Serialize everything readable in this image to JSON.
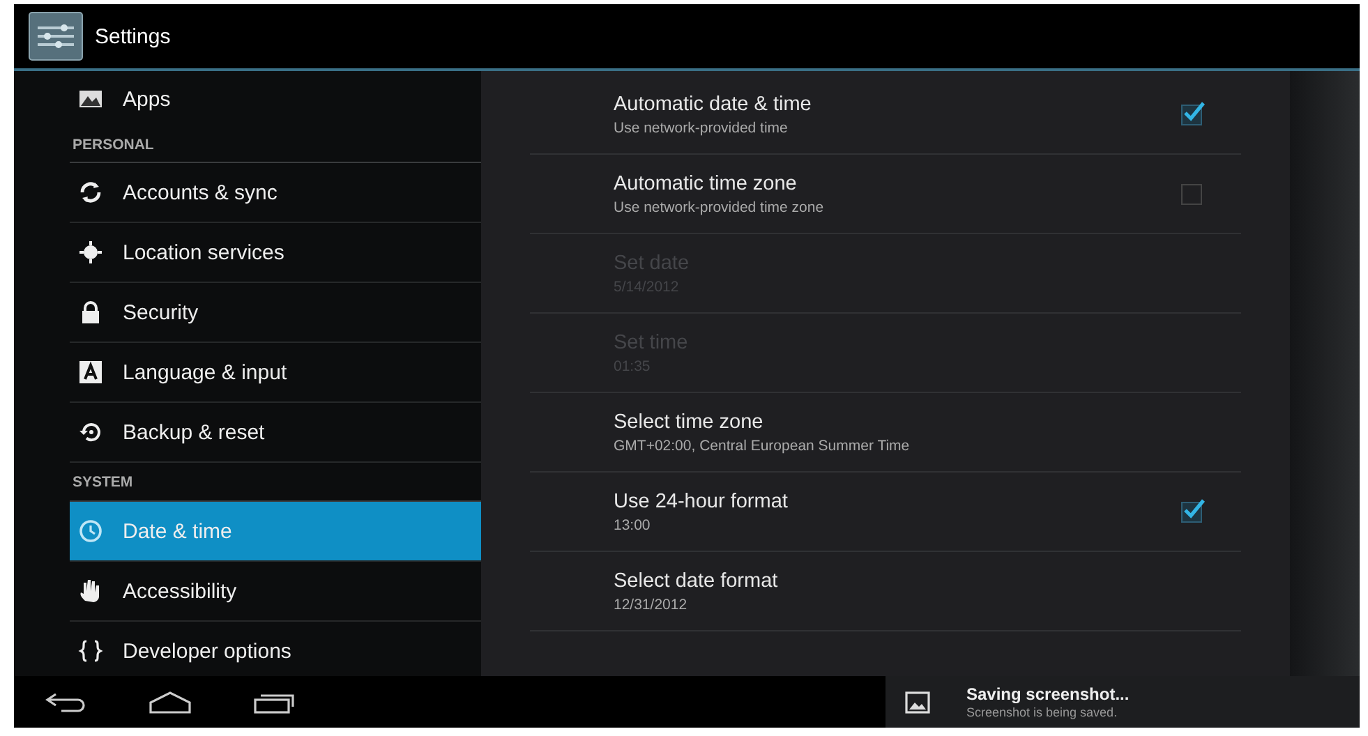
{
  "action_bar": {
    "title": "Settings"
  },
  "sidebar": {
    "items": [
      {
        "kind": "item",
        "label": "Apps",
        "selected": false
      },
      {
        "kind": "header",
        "label": "PERSONAL"
      },
      {
        "kind": "item",
        "label": "Accounts & sync",
        "selected": false
      },
      {
        "kind": "item",
        "label": "Location services",
        "selected": false
      },
      {
        "kind": "item",
        "label": "Security",
        "selected": false
      },
      {
        "kind": "item",
        "label": "Language & input",
        "selected": false
      },
      {
        "kind": "item",
        "label": "Backup & reset",
        "selected": false
      },
      {
        "kind": "header",
        "label": "SYSTEM"
      },
      {
        "kind": "item",
        "label": "Date & time",
        "selected": true
      },
      {
        "kind": "item",
        "label": "Accessibility",
        "selected": false
      },
      {
        "kind": "item",
        "label": "Developer options",
        "selected": false
      }
    ]
  },
  "detail": {
    "rows": [
      {
        "kind": "checkbox",
        "title": "Automatic date & time",
        "summary": "Use network-provided time",
        "checked": true,
        "disabled": false
      },
      {
        "kind": "checkbox",
        "title": "Automatic time zone",
        "summary": "Use network-provided time zone",
        "checked": false,
        "disabled": false
      },
      {
        "kind": "plain",
        "title": "Set date",
        "summary": "5/14/2012",
        "disabled": true
      },
      {
        "kind": "plain",
        "title": "Set time",
        "summary": "01:35",
        "disabled": true
      },
      {
        "kind": "plain",
        "title": "Select time zone",
        "summary": "GMT+02:00, Central European Summer Time",
        "disabled": false
      },
      {
        "kind": "checkbox",
        "title": "Use 24-hour format",
        "summary": "13:00",
        "checked": true,
        "disabled": false
      },
      {
        "kind": "plain",
        "title": "Select date format",
        "summary": "12/31/2012",
        "disabled": false
      }
    ]
  },
  "notification": {
    "title": "Saving screenshot...",
    "text": "Screenshot is being saved."
  }
}
